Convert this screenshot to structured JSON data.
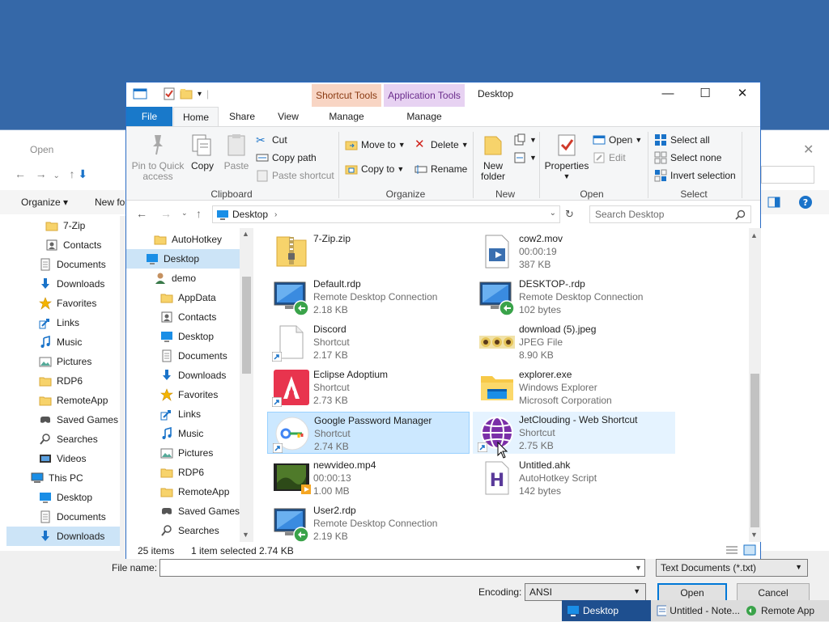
{
  "open_dialog": {
    "title": "Open",
    "toolbar": {
      "organize": "Organize ▾",
      "new_folder": "New fo"
    },
    "nav_items": [
      {
        "label": "7-Zip",
        "icon": "folder-icon",
        "indent": 1
      },
      {
        "label": "Contacts",
        "icon": "contacts-icon",
        "indent": 1
      },
      {
        "label": "Documents",
        "icon": "documents-icon",
        "indent": 0
      },
      {
        "label": "Downloads",
        "icon": "download-icon",
        "indent": 0
      },
      {
        "label": "Favorites",
        "icon": "star-icon",
        "indent": 0
      },
      {
        "label": "Links",
        "icon": "link-icon",
        "indent": 0
      },
      {
        "label": "Music",
        "icon": "music-icon",
        "indent": 0
      },
      {
        "label": "Pictures",
        "icon": "pictures-icon",
        "indent": 0
      },
      {
        "label": "RDP6",
        "icon": "folder-icon",
        "indent": 0
      },
      {
        "label": "RemoteApp",
        "icon": "folder-icon",
        "indent": 0
      },
      {
        "label": "Saved Games",
        "icon": "saved-games-icon",
        "indent": 0
      },
      {
        "label": "Searches",
        "icon": "search-icon",
        "indent": 0
      },
      {
        "label": "Videos",
        "icon": "videos-icon",
        "indent": 0
      },
      {
        "label": "This PC",
        "icon": "computer-icon",
        "indent": -1
      },
      {
        "label": "Desktop",
        "icon": "desktop-icon",
        "indent": 0
      },
      {
        "label": "Documents",
        "icon": "documents-icon",
        "indent": 0
      },
      {
        "label": "Downloads",
        "icon": "download-icon",
        "indent": 0,
        "selected": true
      }
    ],
    "filename_label": "File name:",
    "filename_value": "",
    "filetype": "Text Documents (*.txt)",
    "encoding_label": "Encoding:",
    "encoding_value": "ANSI",
    "open_button": "Open",
    "cancel_button": "Cancel"
  },
  "taskbar": [
    {
      "label": "Desktop",
      "icon": "desktop-icon"
    },
    {
      "label": "Untitled - Note...",
      "icon": "notepad-icon"
    },
    {
      "label": "Remote App",
      "icon": "remote-desktop-icon"
    }
  ],
  "explorer": {
    "title": "Desktop",
    "context_tabs": {
      "shortcut_tools": "Shortcut Tools",
      "application_tools": "Application Tools"
    },
    "tabs": {
      "file": "File",
      "home": "Home",
      "share": "Share",
      "view": "View",
      "manage1": "Manage",
      "manage2": "Manage"
    },
    "ribbon": {
      "pin": "Pin to Quick\naccess",
      "copy": "Copy",
      "paste": "Paste",
      "cut": "Cut",
      "copy_path": "Copy path",
      "paste_shortcut": "Paste shortcut",
      "clipboard": "Clipboard",
      "move_to": "Move to",
      "copy_to": "Copy to",
      "delete": "Delete",
      "rename": "Rename",
      "organize": "Organize",
      "new_folder": "New\nfolder",
      "new": "New",
      "properties": "Properties",
      "open": "Open",
      "edit": "Edit",
      "open_group": "Open",
      "select_all": "Select all",
      "select_none": "Select none",
      "invert_selection": "Invert selection",
      "select": "Select"
    },
    "address": "Desktop",
    "search_placeholder": "Search Desktop",
    "nav_items": [
      {
        "label": "AutoHotkey",
        "icon": "folder-icon",
        "x": 34
      },
      {
        "label": "Desktop",
        "icon": "desktop-icon",
        "x": 24,
        "selected": true
      },
      {
        "label": "demo",
        "icon": "user-icon",
        "x": 34
      },
      {
        "label": "AppData",
        "icon": "folder-icon",
        "x": 42
      },
      {
        "label": "Contacts",
        "icon": "contacts-icon",
        "x": 42
      },
      {
        "label": "Desktop",
        "icon": "desktop-icon",
        "x": 42
      },
      {
        "label": "Documents",
        "icon": "documents-icon",
        "x": 42
      },
      {
        "label": "Downloads",
        "icon": "download-icon",
        "x": 42
      },
      {
        "label": "Favorites",
        "icon": "star-icon",
        "x": 42
      },
      {
        "label": "Links",
        "icon": "link-icon",
        "x": 42
      },
      {
        "label": "Music",
        "icon": "music-icon",
        "x": 42
      },
      {
        "label": "Pictures",
        "icon": "pictures-icon",
        "x": 42
      },
      {
        "label": "RDP6",
        "icon": "folder-icon",
        "x": 42
      },
      {
        "label": "RemoteApp",
        "icon": "folder-icon",
        "x": 42
      },
      {
        "label": "Saved Games",
        "icon": "saved-games-icon",
        "x": 42
      },
      {
        "label": "Searches",
        "icon": "search-icon",
        "x": 42
      }
    ],
    "files": [
      {
        "name": "7-Zip.zip",
        "l2": "",
        "l3": "",
        "icon": "zip-folder-icon",
        "shortcut": false
      },
      {
        "name": "cow2.mov",
        "l2": "00:00:19",
        "l3": "387 KB",
        "icon": "video-file-icon",
        "shortcut": false
      },
      {
        "name": "Default.rdp",
        "l2": "Remote Desktop Connection",
        "l3": "2.18 KB",
        "icon": "remote-desktop-icon",
        "shortcut": false
      },
      {
        "name": "DESKTOP-.rdp",
        "l2": "Remote Desktop Connection",
        "l3": "102 bytes",
        "icon": "remote-desktop-icon",
        "shortcut": false
      },
      {
        "name": "Discord",
        "l2": "Shortcut",
        "l3": "2.17 KB",
        "icon": "blank-file-icon",
        "shortcut": true
      },
      {
        "name": "download (5).jpeg",
        "l2": "JPEG File",
        "l3": "8.90 KB",
        "icon": "jpeg-thumbnail-icon",
        "shortcut": false
      },
      {
        "name": "Eclipse Adoptium",
        "l2": "Shortcut",
        "l3": "2.73 KB",
        "icon": "adoptium-icon",
        "shortcut": true
      },
      {
        "name": "explorer.exe",
        "l2": "Windows Explorer",
        "l3": "Microsoft Corporation",
        "icon": "explorer-icon",
        "shortcut": false
      },
      {
        "name": "Google Password Manager",
        "l2": "Shortcut",
        "l3": "2.74 KB",
        "icon": "password-key-icon",
        "shortcut": true,
        "selected": true
      },
      {
        "name": "JetClouding - Web Shortcut",
        "l2": "Shortcut",
        "l3": "2.75 KB",
        "icon": "globe-icon",
        "shortcut": true,
        "hover": true
      },
      {
        "name": "newvideo.mp4",
        "l2": "00:00:13",
        "l3": "1.00 MB",
        "icon": "video-thumbnail-icon",
        "shortcut": false
      },
      {
        "name": "Untitled.ahk",
        "l2": "AutoHotkey Script",
        "l3": "142 bytes",
        "icon": "ahk-script-icon",
        "shortcut": false
      },
      {
        "name": "User2.rdp",
        "l2": "Remote Desktop Connection",
        "l3": "2.19 KB",
        "icon": "remote-desktop-icon",
        "shortcut": false
      }
    ],
    "status": {
      "count": "25 items",
      "selected": "1 item selected",
      "size": "2.74 KB"
    }
  },
  "colors": {
    "accent": "#1979ca",
    "selection": "#cce8ff",
    "desktop": "#3568a8"
  }
}
